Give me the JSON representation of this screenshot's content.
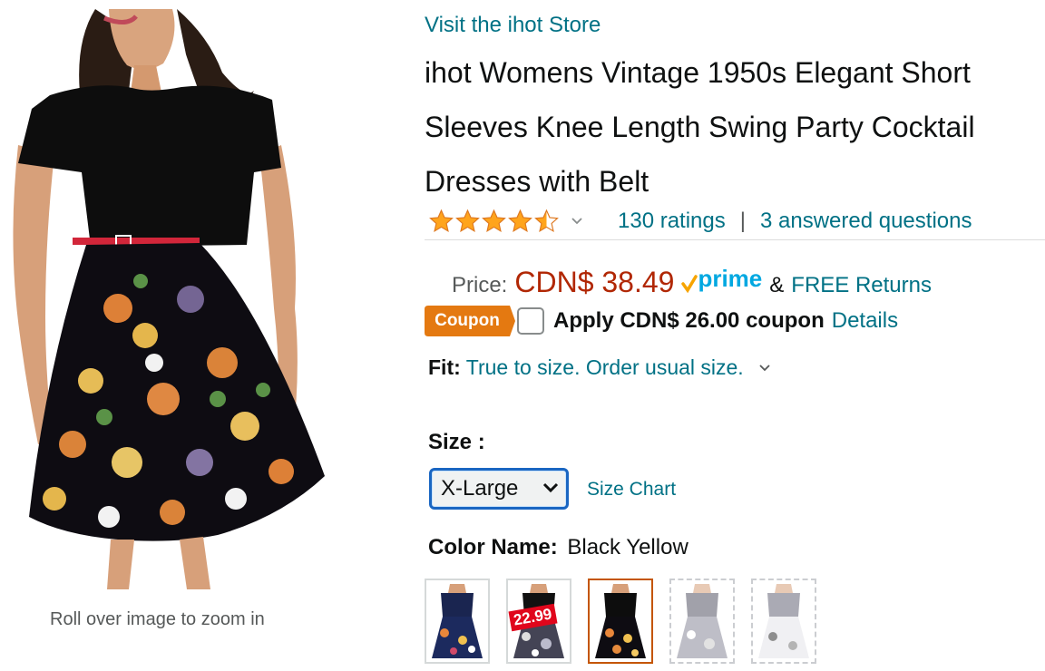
{
  "store": {
    "link_text": "Visit the ihot Store"
  },
  "product": {
    "title": "ihot Womens Vintage 1950s Elegant Short Sleeves Knee Length Swing Party Cocktail Dresses with Belt",
    "image_hint": "Roll over image to zoom in"
  },
  "rating": {
    "value": 4.5,
    "ratings_text": "130 ratings",
    "separator": "|",
    "questions_text": "3 answered questions"
  },
  "price": {
    "label": "Price:",
    "value": "CDN$ 38.49",
    "prime_text": "prime",
    "amp": "&",
    "returns_text": "FREE Returns"
  },
  "coupon": {
    "badge": "Coupon",
    "apply_text": "Apply CDN$ 26.00 coupon",
    "details_text": "Details",
    "checked": false
  },
  "fit": {
    "label": "Fit:",
    "value": "True to size. Order usual size."
  },
  "size": {
    "label": "Size :",
    "selected": "X-Large",
    "chart_link": "Size Chart"
  },
  "color": {
    "label": "Color Name:",
    "value": "Black Yellow",
    "swatches": [
      {
        "name": "Navy Floral",
        "state": "available"
      },
      {
        "name": "Black White Floral",
        "state": "available",
        "tag": "22.99"
      },
      {
        "name": "Black Yellow",
        "state": "selected"
      },
      {
        "name": "Grey Floral",
        "state": "unavailable"
      },
      {
        "name": "White Floral",
        "state": "unavailable"
      }
    ]
  },
  "colors": {
    "link": "#007185",
    "price": "#b12704",
    "coupon": "#e47911",
    "star": "#ffa41c",
    "prime_blue": "#00a8e1",
    "selected_swatch": "#c45500",
    "focus_blue": "#1a66c2"
  }
}
